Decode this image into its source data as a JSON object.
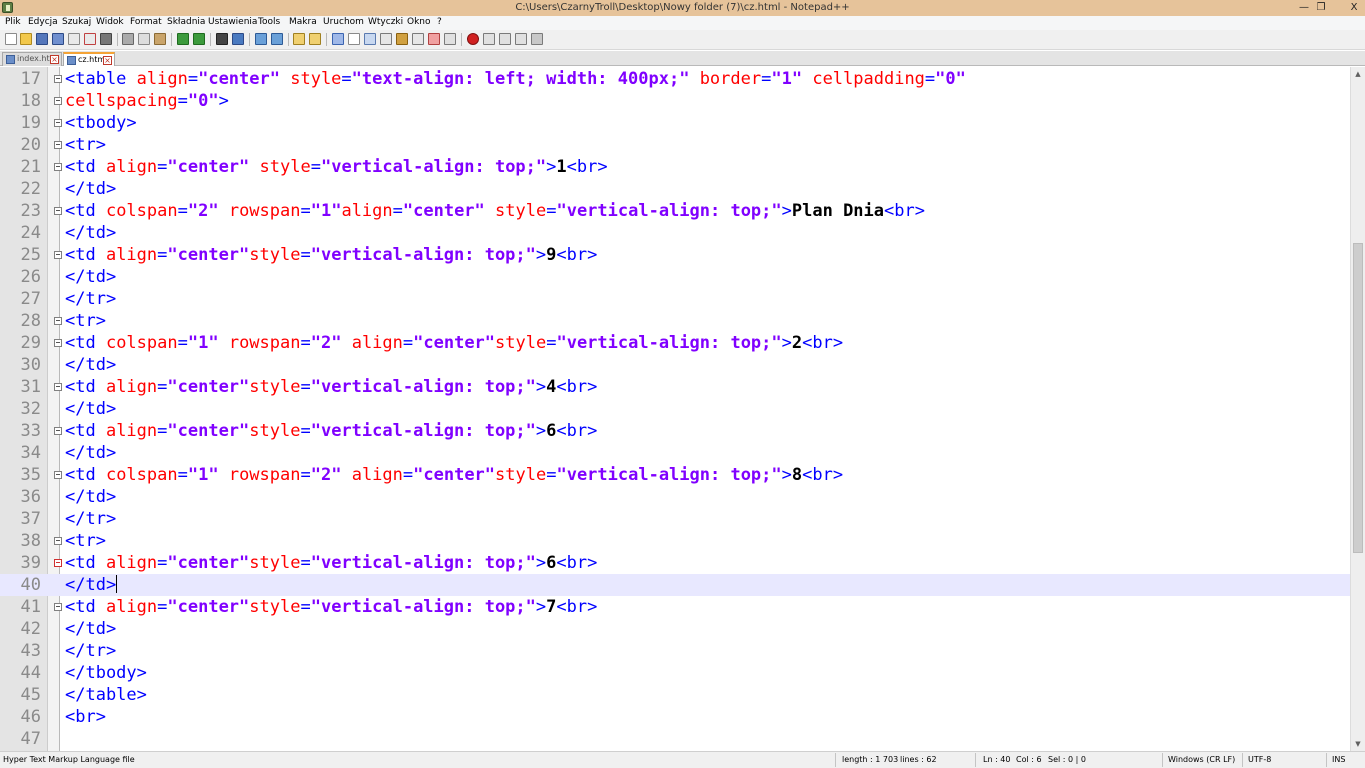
{
  "window": {
    "title": "C:\\Users\\CzarnyTroll\\Desktop\\Nowy folder (7)\\cz.html - Notepad++",
    "minimize_label": "—",
    "restore_label": "❐",
    "close_label": "X"
  },
  "menu": {
    "items": [
      "Plik",
      "Edycja",
      "Szukaj",
      "Widok",
      "Format",
      "Składnia",
      "Ustawienia",
      "Tools",
      "Makra",
      "Uruchom",
      "Wtyczki",
      "Okno",
      "?"
    ]
  },
  "tabs": [
    {
      "label": "index.html",
      "active": false
    },
    {
      "label": "cz.html",
      "active": true
    }
  ],
  "editor": {
    "lines": [
      {
        "n": "17",
        "parts": [
          [
            "tg",
            "<table "
          ],
          [
            "at",
            "align"
          ],
          [
            "tg",
            "="
          ],
          [
            "av",
            "\"center\""
          ],
          [
            "tg",
            " "
          ],
          [
            "at",
            "style"
          ],
          [
            "tg",
            "="
          ],
          [
            "av",
            "\"text-align: left; width: 400px;\""
          ],
          [
            "tg",
            " "
          ],
          [
            "at",
            "border"
          ],
          [
            "tg",
            "="
          ],
          [
            "av",
            "\"1\""
          ],
          [
            "tg",
            " "
          ],
          [
            "at",
            "cellpadding"
          ],
          [
            "tg",
            "="
          ],
          [
            "av",
            "\"0\""
          ]
        ]
      },
      {
        "n": "18",
        "parts": [
          [
            "at",
            "cellspacing"
          ],
          [
            "tg",
            "="
          ],
          [
            "av",
            "\"0\""
          ],
          [
            "tg",
            ">"
          ]
        ]
      },
      {
        "n": "19",
        "parts": [
          [
            "tg",
            "<tbody>"
          ]
        ]
      },
      {
        "n": "20",
        "parts": [
          [
            "tg",
            "<tr>"
          ]
        ]
      },
      {
        "n": "21",
        "parts": [
          [
            "tg",
            "<td "
          ],
          [
            "at",
            "align"
          ],
          [
            "tg",
            "="
          ],
          [
            "av",
            "\"center\""
          ],
          [
            "tg",
            " "
          ],
          [
            "at",
            "style"
          ],
          [
            "tg",
            "="
          ],
          [
            "av",
            "\"vertical-align: top;\""
          ],
          [
            "tg",
            ">"
          ],
          [
            "tx",
            "1"
          ],
          [
            "tg",
            "<br>"
          ]
        ]
      },
      {
        "n": "22",
        "parts": [
          [
            "tg",
            "</td>"
          ]
        ]
      },
      {
        "n": "23",
        "parts": [
          [
            "tg",
            "<td "
          ],
          [
            "at",
            "colspan"
          ],
          [
            "tg",
            "="
          ],
          [
            "av",
            "\"2\""
          ],
          [
            "tg",
            " "
          ],
          [
            "at",
            "rowspan"
          ],
          [
            "tg",
            "="
          ],
          [
            "av",
            "\"1\""
          ],
          [
            "at",
            "align"
          ],
          [
            "tg",
            "="
          ],
          [
            "av",
            "\"center\""
          ],
          [
            "tg",
            " "
          ],
          [
            "at",
            "style"
          ],
          [
            "tg",
            "="
          ],
          [
            "av",
            "\"vertical-align: top;\""
          ],
          [
            "tg",
            ">"
          ],
          [
            "tx",
            "Plan Dnia"
          ],
          [
            "tg",
            "<br>"
          ]
        ]
      },
      {
        "n": "24",
        "parts": [
          [
            "tg",
            "</td>"
          ]
        ]
      },
      {
        "n": "25",
        "parts": [
          [
            "tg",
            "<td "
          ],
          [
            "at",
            "align"
          ],
          [
            "tg",
            "="
          ],
          [
            "av",
            "\"center\""
          ],
          [
            "at",
            "style"
          ],
          [
            "tg",
            "="
          ],
          [
            "av",
            "\"vertical-align: top;\""
          ],
          [
            "tg",
            ">"
          ],
          [
            "tx",
            "9"
          ],
          [
            "tg",
            "<br>"
          ]
        ]
      },
      {
        "n": "26",
        "parts": [
          [
            "tg",
            "</td>"
          ]
        ]
      },
      {
        "n": "27",
        "parts": [
          [
            "tg",
            "</tr>"
          ]
        ]
      },
      {
        "n": "28",
        "parts": [
          [
            "tg",
            "<tr>"
          ]
        ]
      },
      {
        "n": "29",
        "parts": [
          [
            "tg",
            "<td "
          ],
          [
            "at",
            "colspan"
          ],
          [
            "tg",
            "="
          ],
          [
            "av",
            "\"1\""
          ],
          [
            "tg",
            " "
          ],
          [
            "at",
            "rowspan"
          ],
          [
            "tg",
            "="
          ],
          [
            "av",
            "\"2\""
          ],
          [
            "tg",
            " "
          ],
          [
            "at",
            "align"
          ],
          [
            "tg",
            "="
          ],
          [
            "av",
            "\"center\""
          ],
          [
            "at",
            "style"
          ],
          [
            "tg",
            "="
          ],
          [
            "av",
            "\"vertical-align: top;\""
          ],
          [
            "tg",
            ">"
          ],
          [
            "tx",
            "2"
          ],
          [
            "tg",
            "<br>"
          ]
        ]
      },
      {
        "n": "30",
        "parts": [
          [
            "tg",
            "</td>"
          ]
        ]
      },
      {
        "n": "31",
        "parts": [
          [
            "tg",
            "<td "
          ],
          [
            "at",
            "align"
          ],
          [
            "tg",
            "="
          ],
          [
            "av",
            "\"center\""
          ],
          [
            "at",
            "style"
          ],
          [
            "tg",
            "="
          ],
          [
            "av",
            "\"vertical-align: top;\""
          ],
          [
            "tg",
            ">"
          ],
          [
            "tx",
            "4"
          ],
          [
            "tg",
            "<br>"
          ]
        ]
      },
      {
        "n": "32",
        "parts": [
          [
            "tg",
            "</td>"
          ]
        ]
      },
      {
        "n": "33",
        "parts": [
          [
            "tg",
            "<td "
          ],
          [
            "at",
            "align"
          ],
          [
            "tg",
            "="
          ],
          [
            "av",
            "\"center\""
          ],
          [
            "at",
            "style"
          ],
          [
            "tg",
            "="
          ],
          [
            "av",
            "\"vertical-align: top;\""
          ],
          [
            "tg",
            ">"
          ],
          [
            "tx",
            "6"
          ],
          [
            "tg",
            "<br>"
          ]
        ]
      },
      {
        "n": "34",
        "parts": [
          [
            "tg",
            "</td>"
          ]
        ]
      },
      {
        "n": "35",
        "parts": [
          [
            "tg",
            "<td "
          ],
          [
            "at",
            "colspan"
          ],
          [
            "tg",
            "="
          ],
          [
            "av",
            "\"1\""
          ],
          [
            "tg",
            " "
          ],
          [
            "at",
            "rowspan"
          ],
          [
            "tg",
            "="
          ],
          [
            "av",
            "\"2\""
          ],
          [
            "tg",
            " "
          ],
          [
            "at",
            "align"
          ],
          [
            "tg",
            "="
          ],
          [
            "av",
            "\"center\""
          ],
          [
            "at",
            "style"
          ],
          [
            "tg",
            "="
          ],
          [
            "av",
            "\"vertical-align: top;\""
          ],
          [
            "tg",
            ">"
          ],
          [
            "tx",
            "8"
          ],
          [
            "tg",
            "<br>"
          ]
        ]
      },
      {
        "n": "36",
        "parts": [
          [
            "tg",
            "</td>"
          ]
        ]
      },
      {
        "n": "37",
        "parts": [
          [
            "tg",
            "</tr>"
          ]
        ]
      },
      {
        "n": "38",
        "parts": [
          [
            "tg",
            "<tr>"
          ]
        ]
      },
      {
        "n": "39",
        "parts": [
          [
            "tg",
            "<td "
          ],
          [
            "at",
            "align"
          ],
          [
            "tg",
            "="
          ],
          [
            "av",
            "\"center\""
          ],
          [
            "at",
            "style"
          ],
          [
            "tg",
            "="
          ],
          [
            "av",
            "\"vertical-align: top;\""
          ],
          [
            "tg",
            ">"
          ],
          [
            "tx",
            "6"
          ],
          [
            "tg",
            "<br>"
          ]
        ]
      },
      {
        "n": "40",
        "parts": [
          [
            "tg",
            "</td>"
          ]
        ]
      },
      {
        "n": "41",
        "parts": [
          [
            "tg",
            "<td "
          ],
          [
            "at",
            "align"
          ],
          [
            "tg",
            "="
          ],
          [
            "av",
            "\"center\""
          ],
          [
            "at",
            "style"
          ],
          [
            "tg",
            "="
          ],
          [
            "av",
            "\"vertical-align: top;\""
          ],
          [
            "tg",
            ">"
          ],
          [
            "tx",
            "7"
          ],
          [
            "tg",
            "<br>"
          ]
        ]
      },
      {
        "n": "42",
        "parts": [
          [
            "tg",
            "</td>"
          ]
        ]
      },
      {
        "n": "43",
        "parts": [
          [
            "tg",
            "</tr>"
          ]
        ]
      },
      {
        "n": "44",
        "parts": [
          [
            "tg",
            "</tbody>"
          ]
        ]
      },
      {
        "n": "45",
        "parts": [
          [
            "tg",
            "</table>"
          ]
        ]
      },
      {
        "n": "46",
        "parts": [
          [
            "tg",
            "<br>"
          ]
        ]
      },
      {
        "n": "47",
        "parts": []
      }
    ],
    "fold_lines": [
      "17",
      "18",
      "19",
      "20",
      "21",
      "23",
      "25",
      "28",
      "29",
      "31",
      "33",
      "35",
      "38",
      "39",
      "41"
    ],
    "red_fold_lines": [
      "39"
    ],
    "current_line": "40"
  },
  "colors": {
    "tag": "#0000ff",
    "attribute": "#ff0000",
    "value": "#8000ff",
    "text": "#000000",
    "current_line": "#e8e8ff",
    "titlebar": "#e6c39a"
  },
  "status": {
    "file_type": "Hyper Text Markup Language file",
    "length": "length : 1 703",
    "lines": "lines : 62",
    "ln": "Ln : 40",
    "col": "Col : 6",
    "sel": "Sel : 0 | 0",
    "eol": "Windows (CR LF)",
    "encoding": "UTF-8",
    "mode": "INS"
  }
}
